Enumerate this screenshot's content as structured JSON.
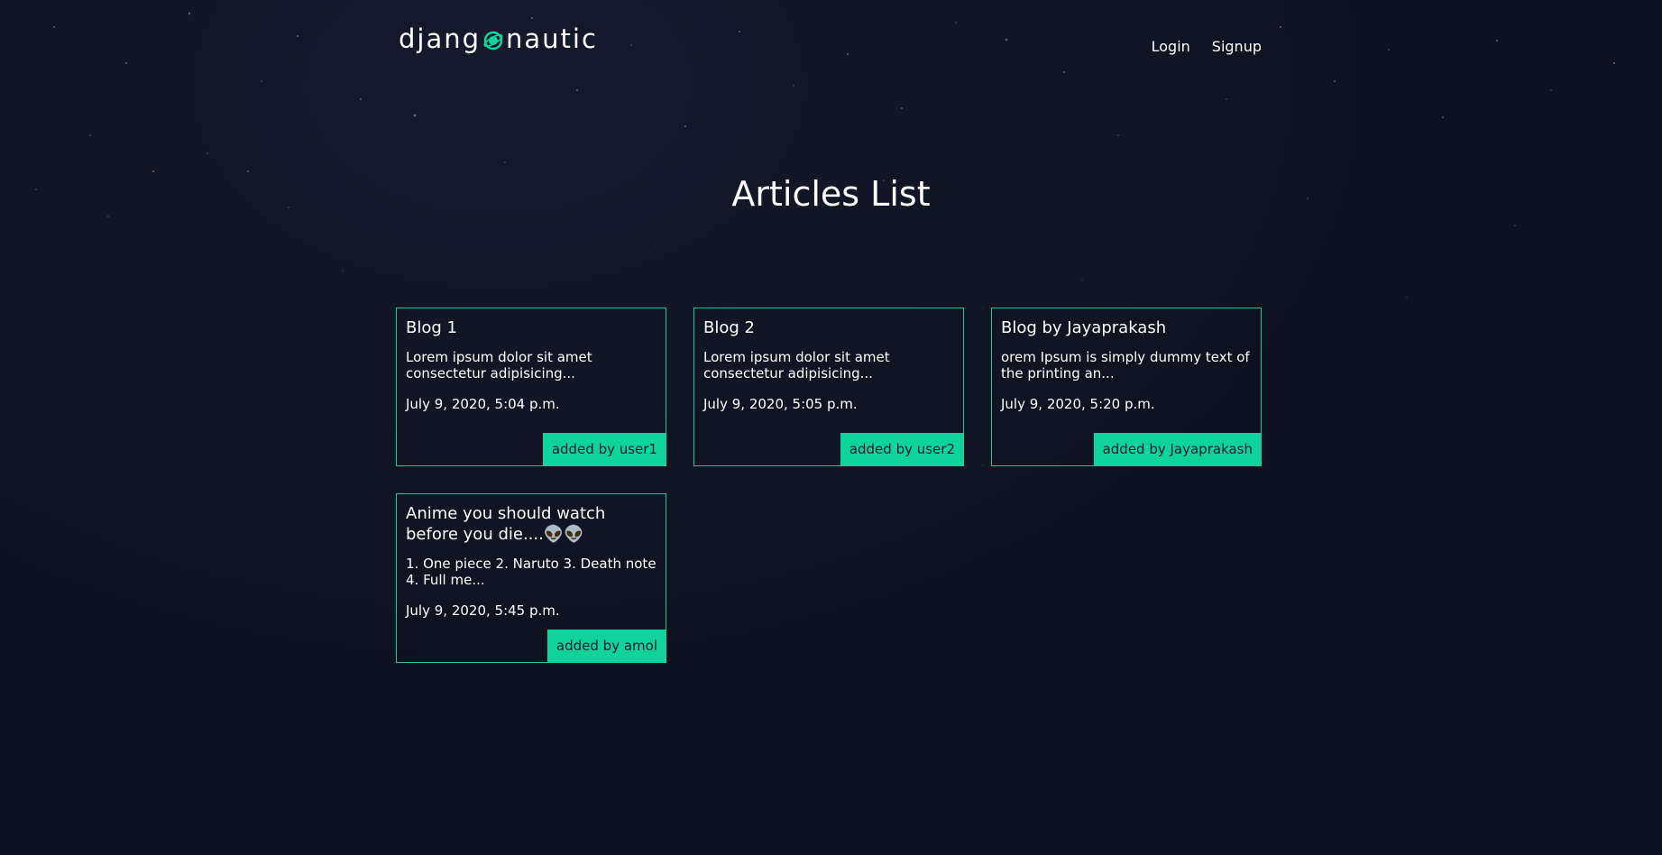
{
  "header": {
    "logo_left": "djang",
    "logo_right": "nautic",
    "nav": {
      "login": "Login",
      "signup": "Signup"
    }
  },
  "main": {
    "title": "Articles List",
    "articles": [
      {
        "title": "Blog 1",
        "snippet": "Lorem ipsum dolor sit amet consectetur adipisicing...",
        "date": "July 9, 2020, 5:04 p.m.",
        "author": "added by user1"
      },
      {
        "title": "Blog 2",
        "snippet": "Lorem ipsum dolor sit amet consectetur adipisicing...",
        "date": "July 9, 2020, 5:05 p.m.",
        "author": "added by user2"
      },
      {
        "title": "Blog by Jayaprakash",
        "snippet": "orem Ipsum is simply dummy text of the printing an...",
        "date": "July 9, 2020, 5:20 p.m.",
        "author": "added by Jayaprakash"
      },
      {
        "title": "Anime you should watch before you die....👽👽",
        "snippet": "1. One piece 2. Naruto 3. Death note 4. Full me...",
        "date": "July 9, 2020, 5:45 p.m.",
        "author": "added by amol"
      }
    ]
  },
  "colors": {
    "background": "#0e1220",
    "accent": "#0ed39d",
    "border": "#13c998"
  },
  "icons": {
    "logo_mark": "planet-ring-icon"
  }
}
